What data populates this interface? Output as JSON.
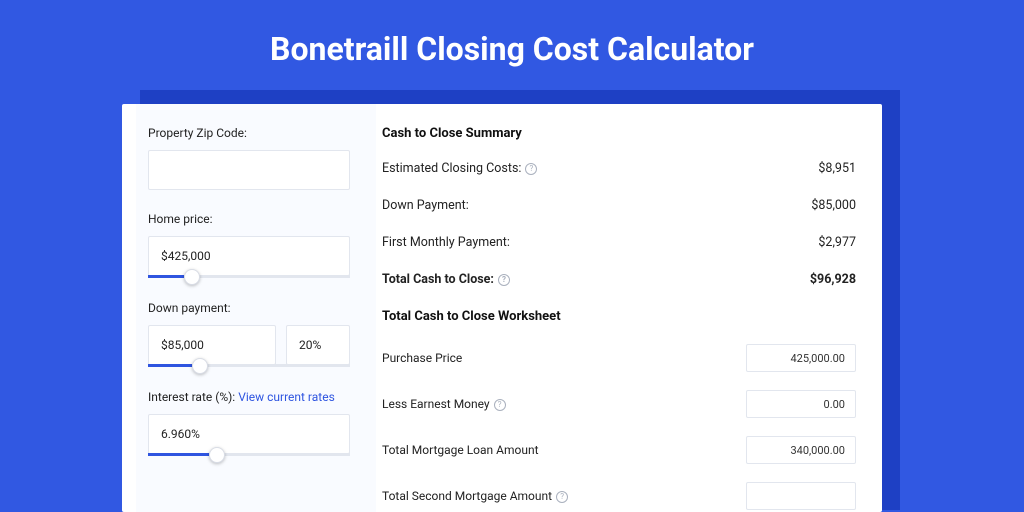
{
  "page": {
    "title": "Bonetraill Closing Cost Calculator"
  },
  "left": {
    "zip_label": "Property Zip Code:",
    "zip_value": "",
    "home_price_label": "Home price:",
    "home_price_value": "$425,000",
    "down_payment_label": "Down payment:",
    "down_payment_value": "$85,000",
    "down_payment_pct": "20%",
    "interest_label": "Interest rate (%): ",
    "interest_link": "View current rates",
    "interest_value": "6.960%"
  },
  "summary": {
    "title": "Cash to Close Summary",
    "rows": [
      {
        "label": "Estimated Closing Costs:",
        "help": true,
        "value": "$8,951"
      },
      {
        "label": "Down Payment:",
        "help": false,
        "value": "$85,000"
      },
      {
        "label": "First Monthly Payment:",
        "help": false,
        "value": "$2,977"
      }
    ],
    "total_label": "Total Cash to Close:",
    "total_value": "$96,928"
  },
  "worksheet": {
    "title": "Total Cash to Close Worksheet",
    "rows": [
      {
        "label": "Purchase Price",
        "help": false,
        "value": "425,000.00"
      },
      {
        "label": "Less Earnest Money",
        "help": true,
        "value": "0.00"
      },
      {
        "label": "Total Mortgage Loan Amount",
        "help": false,
        "value": "340,000.00"
      },
      {
        "label": "Total Second Mortgage Amount",
        "help": true,
        "value": ""
      }
    ]
  }
}
